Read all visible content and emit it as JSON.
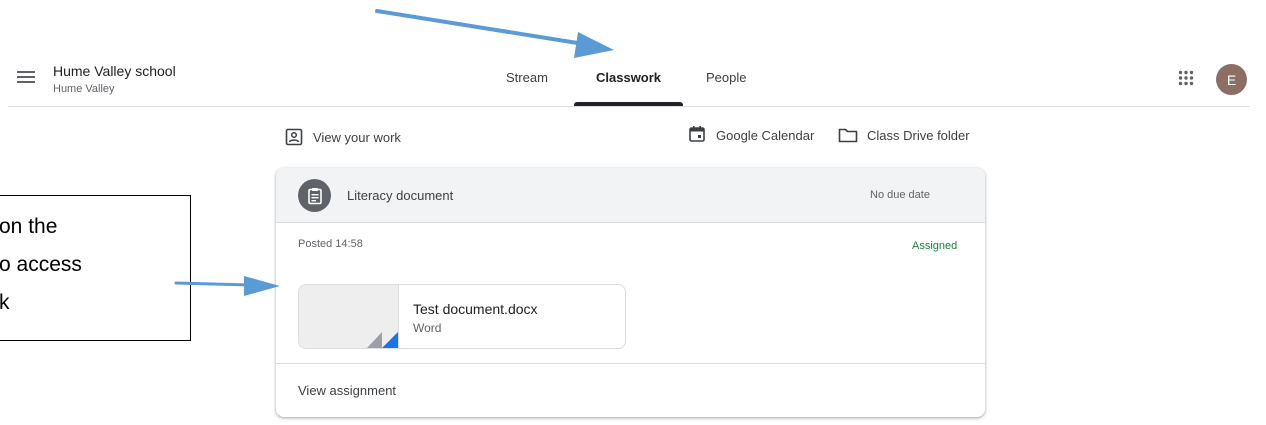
{
  "header": {
    "class_name": "Hume Valley school",
    "class_section": "Hume Valley",
    "tabs": [
      {
        "label": "Stream",
        "active": false
      },
      {
        "label": "Classwork",
        "active": true
      },
      {
        "label": "People",
        "active": false
      }
    ],
    "avatar_initial": "E",
    "avatar_color": "#8d6e63"
  },
  "toolbar": {
    "view_work": "View your work",
    "calendar": "Google Calendar",
    "drive_folder": "Class Drive folder"
  },
  "assignment": {
    "title": "Literacy document",
    "due": "No due date",
    "posted": "Posted 14:58",
    "status": "Assigned",
    "status_color": "#188038",
    "attachment": {
      "name": "Test document.docx",
      "type": "Word"
    },
    "view_link": "View assignment"
  },
  "callout": {
    "lines": [
      "on the",
      "o access",
      "k"
    ]
  },
  "icons": {
    "menu": "hamburger-icon",
    "apps": "apps-grid-icon",
    "view_work": "portrait-icon",
    "calendar": "calendar-icon",
    "drive": "folder-icon",
    "assignment": "clipboard-icon"
  }
}
